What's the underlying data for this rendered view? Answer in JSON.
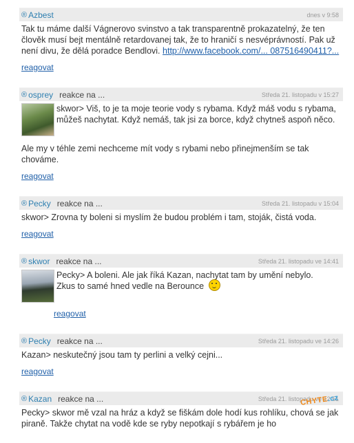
{
  "comments": [
    {
      "author": "Azbest",
      "date": "dnes v 9:58",
      "text": "Tak tu máme další Vágnerovo svinstvo a tak transparentně prokazatelný, že ten člověk musí bejt mentálně retardovanej tak, že to hraničí s nesvéprávností. Pak už není divu, že dělá poradce Bendlovi.",
      "link": "http://www.facebook.com/... 087516490411?...",
      "action": "reagovat"
    },
    {
      "author": "osprey",
      "reply_label": "reakce na ...",
      "date": "Středa 21. listopadu v 15:27",
      "quote": "skwor> Viš, to je ta moje teorie vody s rybama. Když máš vodu s rybama, můžeš nachytat. Když nemáš, tak jsi za borce, když chytneš aspoň něco.",
      "text": "Ale my v téhle zemi nechceme mít vody s rybami nebo přinejmenším se tak chováme.",
      "action": "reagovat"
    },
    {
      "author": "Pecky",
      "reply_label": "reakce na ...",
      "date": "Středa 21. listopadu v 15:04",
      "text": "skwor> Zrovna ty boleni si myslím že budou problém i tam, stoják, čistá voda.",
      "action": "reagovat"
    },
    {
      "author": "skwor",
      "reply_label": "reakce na ...",
      "date": "Středa 21. listopadu ve 14:41",
      "quote_line1": "Pecky> A boleni. Ale jak říká Kazan, nachytat tam by umění nebylo.",
      "quote_line2": "Zkus to samé hned vedle na Berounce",
      "action": "reagovat"
    },
    {
      "author": "Pecky",
      "reply_label": "reakce na ...",
      "date": "Středa 21. listopadu ve 14:26",
      "text": "Kazan> neskutečný jsou tam ty perlini a velký cejni...",
      "action": "reagovat"
    },
    {
      "author": "Kazan",
      "reply_label": "reakce na ...",
      "date": "Středa 21. listopadu ve 12:51",
      "text": "Pecky> skwor mě vzal na hráz a když se fiškám dole hodí kus rohlíku, chová se jak piraně. Takže chytat na vodě kde se ryby nepotkají s rybářem je ho"
    }
  ],
  "watermark": {
    "part1": "CHYTE",
    "part2": ".cz"
  },
  "colors": {
    "author": "#2e7fb0",
    "link": "#1f5fa8",
    "header_bg": "#ebebeb",
    "date": "#9a9a9a"
  }
}
